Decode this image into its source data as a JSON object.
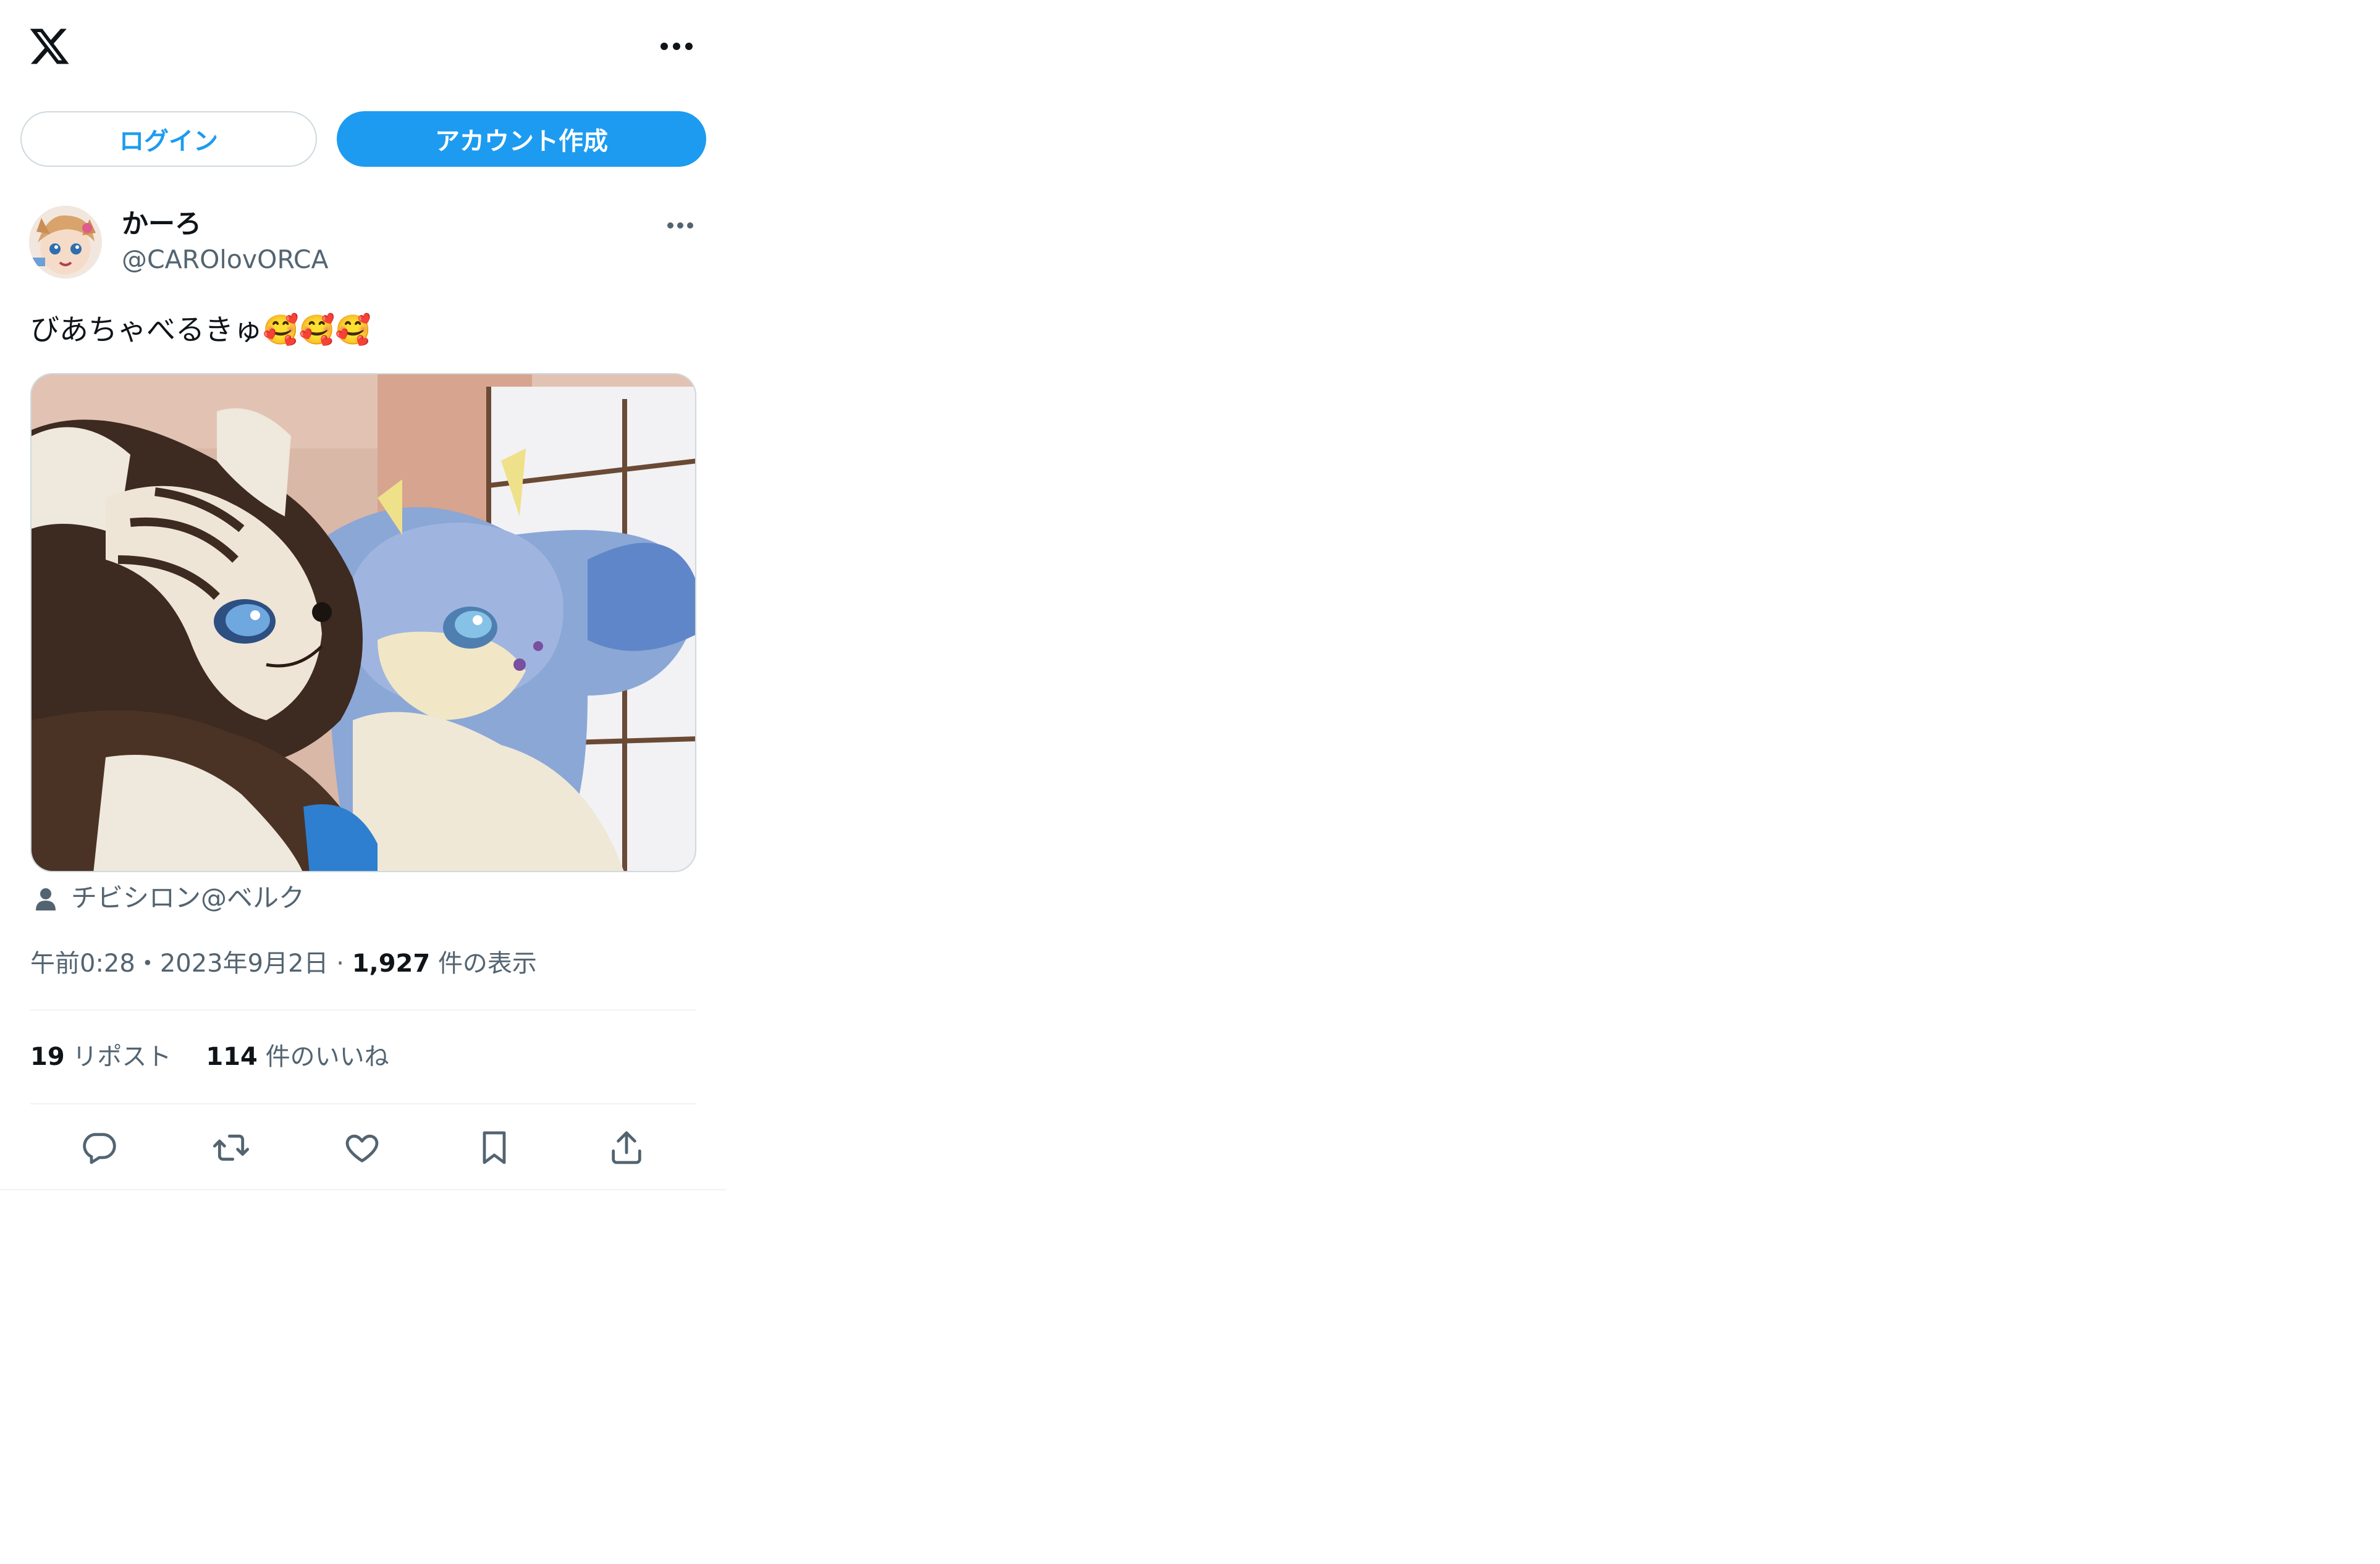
{
  "header": {
    "logo_icon": "x-logo-icon",
    "more_icon": "more-horizontal-icon"
  },
  "auth": {
    "login_label": "ログイン",
    "signup_label": "アカウント作成"
  },
  "tweet": {
    "author": {
      "display_name": "かーろ",
      "handle": "@CAROlovORCA",
      "avatar": "avatar-illustration"
    },
    "text": "びあちゃべるきゅ🥰🥰🥰",
    "media": {
      "description_icon": "photo-two-fursuits"
    },
    "tagged_user": "チビシロン@ベルク",
    "time": "午前0:28",
    "date": "2023年9月2日",
    "views_count": "1,927",
    "views_label": "件の表示",
    "reposts_count": "19",
    "reposts_label": "リポスト",
    "likes_count": "114",
    "likes_label": "件のいいね",
    "separator": "・",
    "dot": "·"
  },
  "actions": [
    "reply-icon",
    "repost-icon",
    "like-icon",
    "bookmark-icon",
    "share-icon"
  ],
  "colors": {
    "accent": "#1d9bf0",
    "text": "#0f1419",
    "secondary": "#536471",
    "border": "#cfd9de",
    "divider": "#eff3f4"
  }
}
